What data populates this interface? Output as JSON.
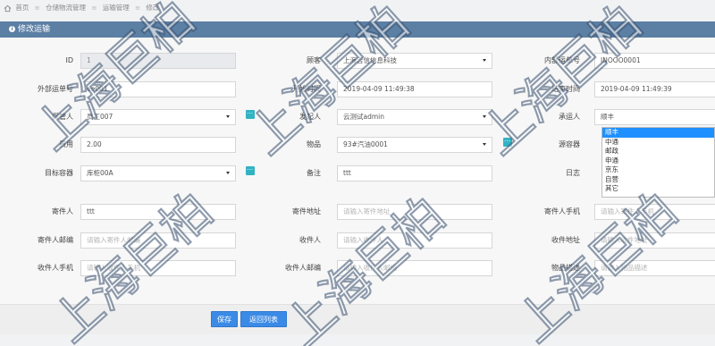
{
  "breadcrumb": [
    "首页",
    "仓储物流管理",
    "运输管理",
    "修改"
  ],
  "panel_title": "修改运输",
  "fields": {
    "id": {
      "label": "ID",
      "value": "1"
    },
    "customer": {
      "label": "顾客",
      "value": "上海吉信信息科技"
    },
    "internal_no": {
      "label": "内部运单号",
      "value": "INOOO0001"
    },
    "external_no": {
      "label": "外部运单号",
      "value": "ee001"
    },
    "start_time": {
      "label": "开始时间",
      "value": "2019-04-09 11:49:38"
    },
    "end_time": {
      "label": "结束时间",
      "value": "2019-04-09 11:49:39"
    },
    "keeper": {
      "label": "保管人",
      "value": "员工007"
    },
    "initiator": {
      "label": "发起人",
      "value": "云测试admin"
    },
    "carrier": {
      "label": "承运人",
      "value": "顺丰"
    },
    "cost": {
      "label": "费用",
      "value": "2.00"
    },
    "goods": {
      "label": "物品",
      "value": "93#汽油0001"
    },
    "source_container": {
      "label": "源容器",
      "value": ""
    },
    "target_container": {
      "label": "目标容器",
      "value": "库柜00A"
    },
    "remark": {
      "label": "备注",
      "value": "ttt"
    },
    "log": {
      "label": "日志",
      "value": ""
    },
    "sender": {
      "label": "寄件人",
      "value": "ttt"
    },
    "sender_address": {
      "label": "寄件地址",
      "placeholder": "请输入寄件地址"
    },
    "sender_phone": {
      "label": "寄件人手机",
      "placeholder": "请输入寄件人手机"
    },
    "sender_email": {
      "label": "寄件人邮编",
      "placeholder": "请输入寄件人邮编"
    },
    "receiver": {
      "label": "收件人",
      "placeholder": "请输入收件人"
    },
    "receiver_address": {
      "label": "收件地址",
      "placeholder": "请输入收件地址"
    },
    "receiver_phone": {
      "label": "收件人手机",
      "placeholder": "请输入收件人手机"
    },
    "receiver_email": {
      "label": "收件人邮编",
      "placeholder": "请输入收件人邮编"
    },
    "goods_desc": {
      "label": "物品描述",
      "placeholder": "请输入物品描述"
    }
  },
  "carrier_options": [
    "顺丰",
    "中通",
    "邮政",
    "申通",
    "京东",
    "自营",
    "其它"
  ],
  "buttons": {
    "save": "保存",
    "back": "返回列表"
  },
  "watermark_text": "上海巨柏",
  "colors": {
    "header": "#5c7fa4",
    "accent": "#3b8ae6",
    "add_button": "#32b3c3",
    "selected_option": "#1e90ff"
  }
}
